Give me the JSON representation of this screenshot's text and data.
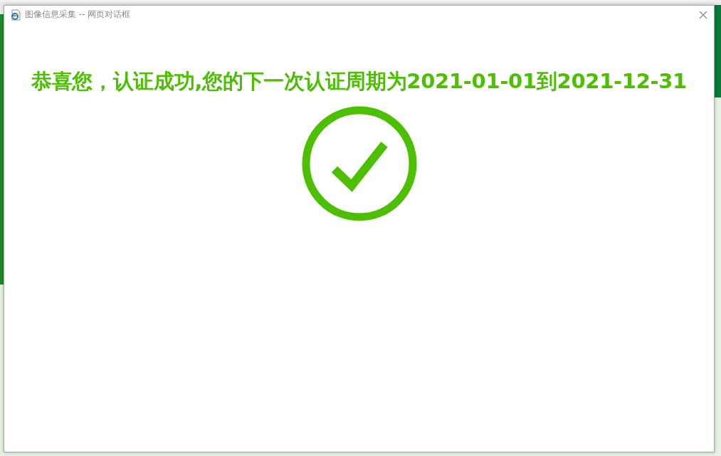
{
  "dialog": {
    "title": "图像信息采集 -- 网页对话框",
    "message": "恭喜您，认证成功,您的下一次认证周期为2021-01-01到2021-12-31",
    "succeeded": true
  }
}
